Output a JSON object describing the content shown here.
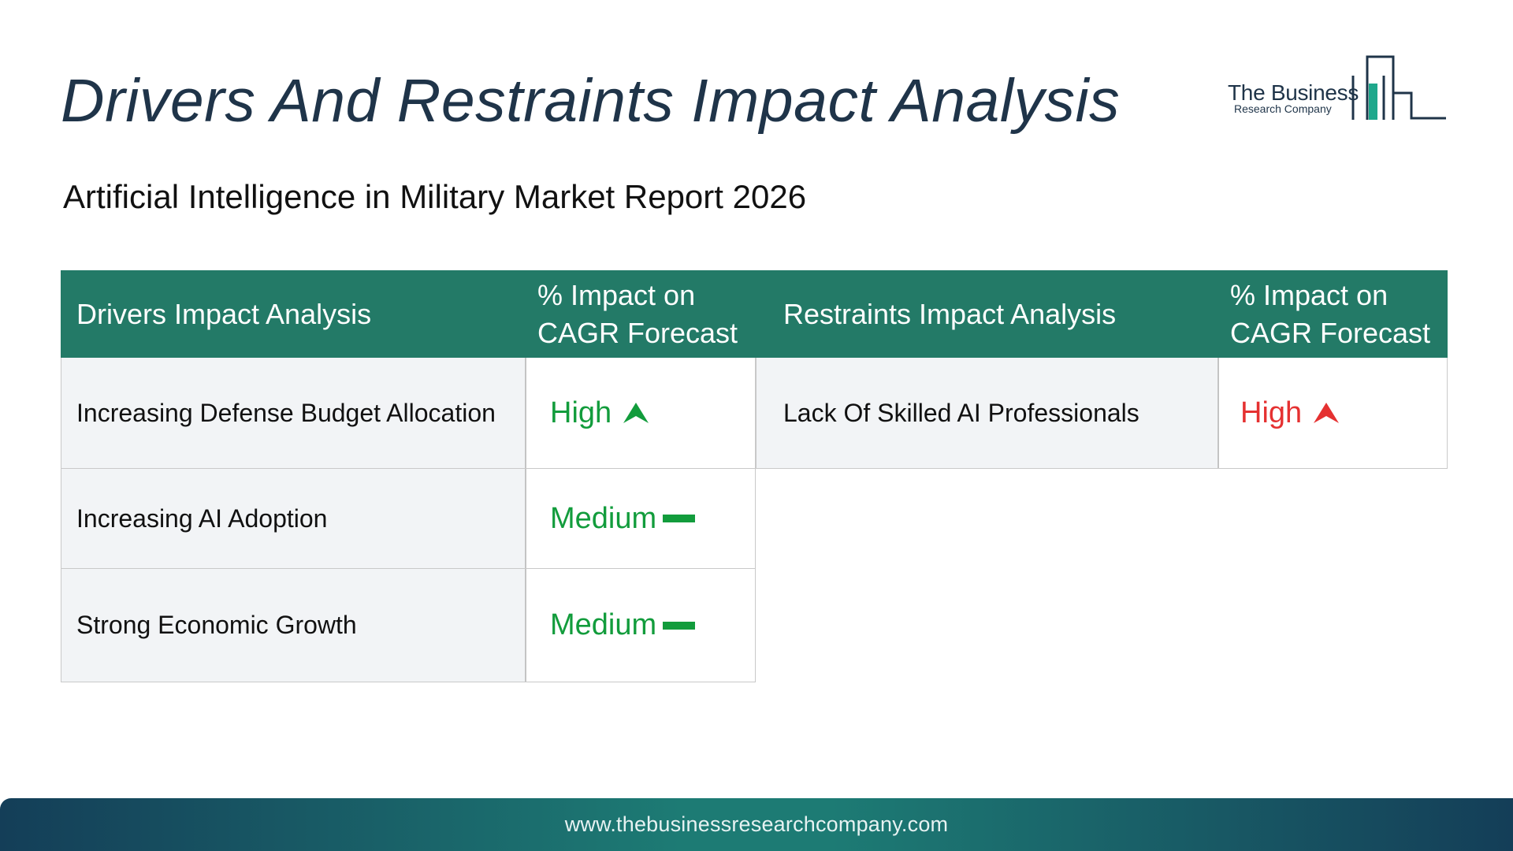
{
  "title": "Drivers And Restraints Impact Analysis",
  "subtitle": "Artificial Intelligence in Military Market Report 2026",
  "logo": {
    "line1": "The Business",
    "line2": "Research Company"
  },
  "drivers_table": {
    "header_name": "Drivers Impact Analysis",
    "header_impact": "% Impact on CAGR Forecast",
    "rows": [
      {
        "name": "Increasing Defense Budget Allocation",
        "impact": "High",
        "indicator": "arrow-up-icon",
        "color": "#129c3c"
      },
      {
        "name": "Increasing AI Adoption",
        "impact": "Medium",
        "indicator": "dash-icon",
        "color": "#129c3c"
      },
      {
        "name": "Strong Economic Growth",
        "impact": "Medium",
        "indicator": "dash-icon",
        "color": "#129c3c"
      }
    ]
  },
  "restraints_table": {
    "header_name": "Restraints Impact Analysis",
    "header_impact": "% Impact on CAGR Forecast",
    "rows": [
      {
        "name": "Lack Of Skilled AI Professionals",
        "impact": "High",
        "indicator": "arrow-up-icon",
        "color": "#e53131"
      }
    ]
  },
  "footer": {
    "url": "www.thebusinessresearchcompany.com"
  },
  "colors": {
    "header_bg": "#237a67",
    "title": "#1f3449",
    "positive": "#129c3c",
    "negative": "#e53131",
    "row_bg": "#f2f4f6"
  }
}
